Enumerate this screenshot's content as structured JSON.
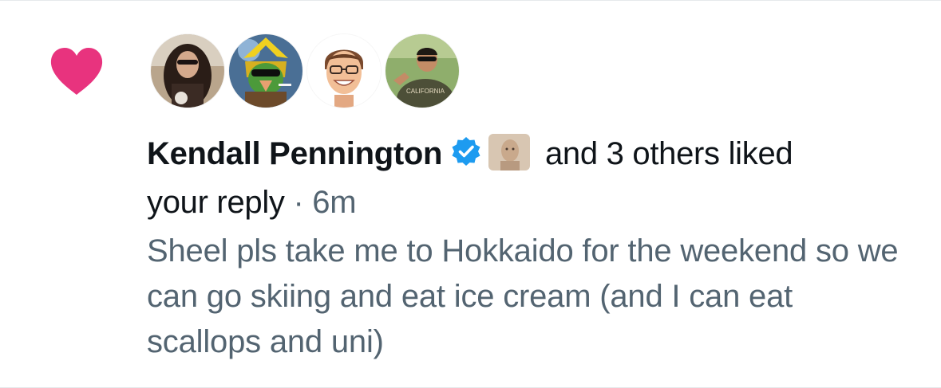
{
  "notification": {
    "type_icon": "heart-icon",
    "accent_color": "#e8337e",
    "liker_avatars": [
      {
        "name": "avatar-woman-sunglasses"
      },
      {
        "name": "avatar-cartoon-character"
      },
      {
        "name": "avatar-smiling-man-glasses"
      },
      {
        "name": "avatar-man-california-shirt"
      }
    ],
    "author_name": "Kendall Pennington",
    "verified_icon": "verified-badge-icon",
    "verified_color": "#1d9bf0",
    "action_line_1": " and 3 others liked",
    "action_line_2": "your reply",
    "separator": " · ",
    "time": "6m",
    "reply_text": "Sheel pls take me to Hokkaido for the weekend so we can go skiing and eat ice cream (and I can eat scallops and uni)"
  }
}
